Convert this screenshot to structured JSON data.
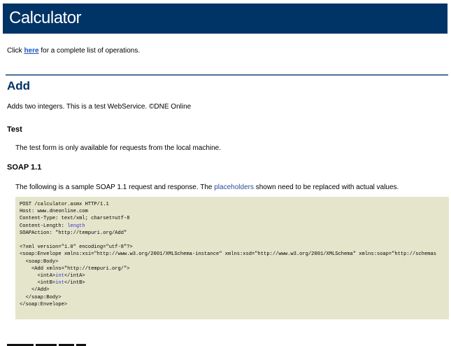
{
  "header": {
    "title": "Calculator"
  },
  "intro": {
    "prefix": "Click ",
    "link": "here",
    "suffix": " for a complete list of operations."
  },
  "operation": {
    "title": "Add",
    "description": "Adds two integers. This is a test WebService. ©DNE Online"
  },
  "test": {
    "heading": "Test",
    "note": "The test form is only available for requests from the local machine."
  },
  "soap": {
    "heading": "SOAP 1.1",
    "desc_prefix": "The following is a sample SOAP 1.1 request and response. The ",
    "desc_link": "placeholders",
    "desc_suffix": " shown need to be replaced with actual values.",
    "lines": [
      {
        "t": "POST /calculator.asmx HTTP/1.1",
        "v": ""
      },
      {
        "t": "Host: www.dneonline.com",
        "v": ""
      },
      {
        "t": "Content-Type: text/xml; charset=utf-8",
        "v": ""
      },
      {
        "t": "Content-Length: ",
        "v": "length"
      },
      {
        "t": "SOAPAction: \"http://tempuri.org/Add\"",
        "v": ""
      },
      {
        "t": "",
        "v": ""
      },
      {
        "t": "<?xml version=\"1.0\" encoding=\"utf-8\"?>",
        "v": ""
      },
      {
        "t": "<soap:Envelope xmlns:xsi=\"http://www.w3.org/2001/XMLSchema-instance\" xmlns:xsd=\"http://www.w3.org/2001/XMLSchema\" xmlns:soap=\"http://schemas",
        "v": ""
      },
      {
        "t": "  <soap:Body>",
        "v": ""
      },
      {
        "t": "    <Add xmlns=\"http://tempuri.org/\">",
        "v": ""
      },
      {
        "t": "      <intA>",
        "v": "int",
        "e": "</intA>"
      },
      {
        "t": "      <intB>",
        "v": "int",
        "e": "</intB>"
      },
      {
        "t": "    </Add>",
        "v": ""
      },
      {
        "t": "  </soap:Body>",
        "v": ""
      },
      {
        "t": "</soap:Envelope>",
        "v": ""
      }
    ]
  }
}
